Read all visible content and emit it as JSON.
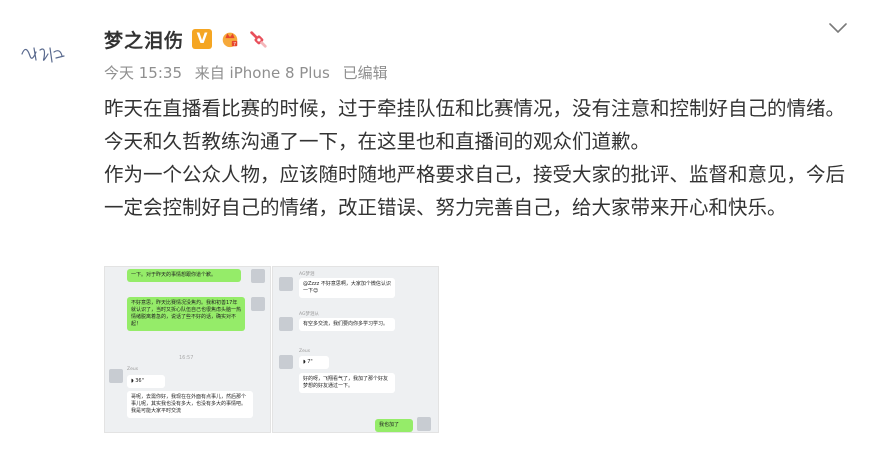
{
  "user": {
    "name": "梦之泪伤",
    "badges": [
      "verified-v-icon",
      "crown-badge-icon",
      "candy-badge-icon"
    ]
  },
  "meta": {
    "time": "今天 15:35",
    "source": "来自 iPhone 8 Plus",
    "edited": "已编辑"
  },
  "post": {
    "paragraph1": "昨天在直播看比赛的时候，过于牵挂队伍和比赛情况，没有注意和控制好自己的情绪。今天和久哲教练沟通了一下，在这里也和直播间的观众们道歉。",
    "paragraph2": "作为一个公众人物，应该随时随地严格要求自己，接受大家的批评、监督和意见，今后一定会控制好自己的情绪，改正错误、努力完善自己，给大家带来开心和快乐。"
  },
  "colors": {
    "accent": "#f5a623",
    "meta_text": "#8f8f8f",
    "chat_green": "#95ec69"
  },
  "images": [
    {
      "bubbles": [
        "一下。对于昨天的事情想跟你道个歉。",
        "不好意思，昨天比赛情况没焦灼。我和初善17年就认识了，当时又拆心队伍自己也很焦虑头脑一热情绪脱离着急的，说话了些不好的话，确实对不起！",
        "36\"",
        "哥呢，去需你好，我现在在外面有点事儿，然后那个事儿呢，其实我也没有多大，也没有多大的事情吧。我是可能大家平时交流"
      ],
      "time": "16:57",
      "sender": "Zeus"
    },
    {
      "bubbles": [
        "@Zzzz 不好意思啊，大家加个微信认识一下😊",
        "有空多交流，我们要向你多学习学习。",
        "7\"",
        "好的呀，飞翔看气了，我加了那个好友梦想的好友通过一下。",
        "我也加了"
      ],
      "names": [
        "AG梦泪",
        "AG梦泪从",
        "Zeus"
      ]
    }
  ]
}
